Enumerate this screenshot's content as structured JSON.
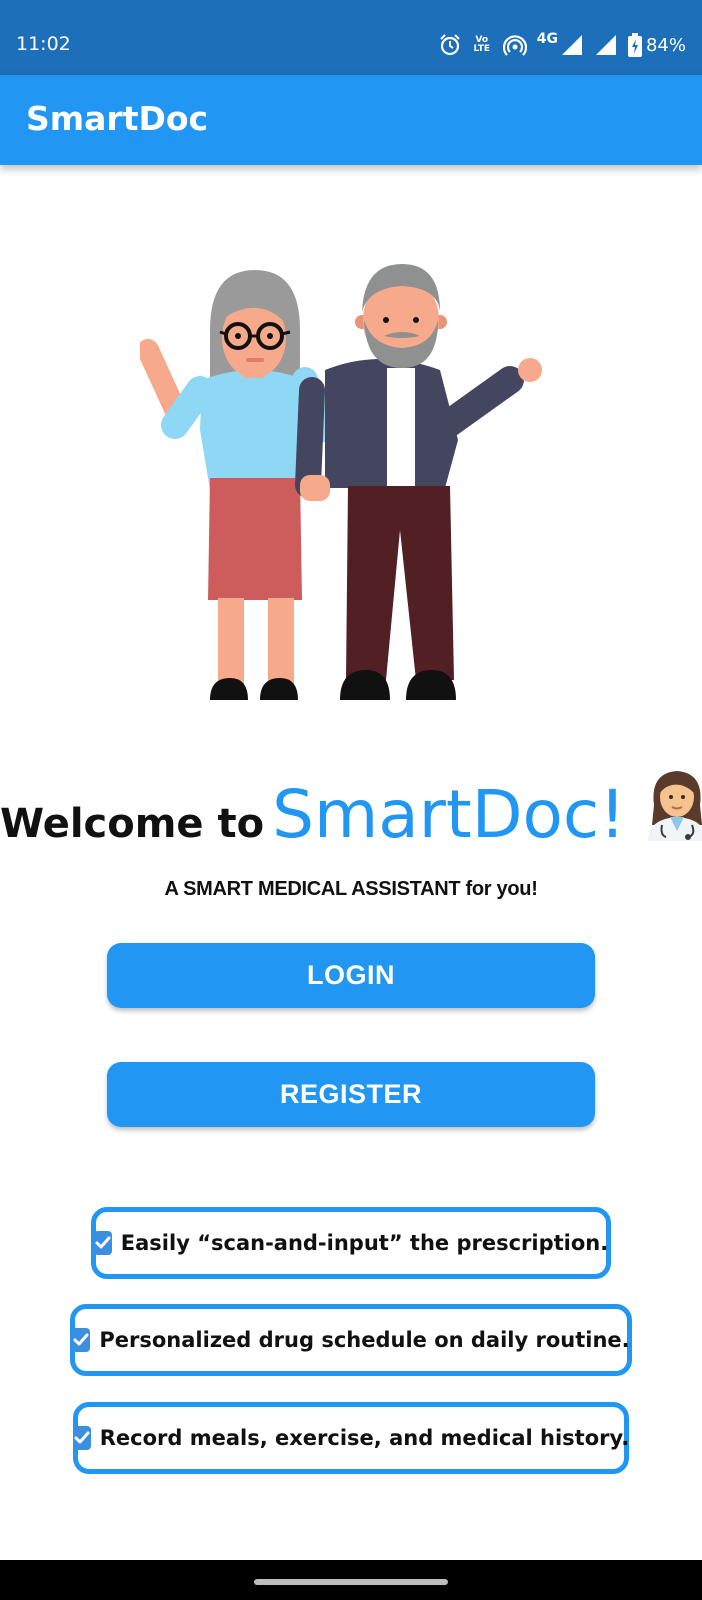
{
  "status_bar": {
    "time": "11:02",
    "network": "4G",
    "volte_label": "Vo LTE",
    "battery": "84%",
    "icons": [
      "alarm-icon",
      "volte-icon",
      "hotspot-icon",
      "signal-icon",
      "signal-icon",
      "battery-charging-icon"
    ]
  },
  "app_bar": {
    "title": "SmartDoc"
  },
  "welcome": {
    "prefix": "Welcome to",
    "brand": "SmartDoc!",
    "emoji": "health-worker-woman-icon"
  },
  "tagline": "A SMART MEDICAL ASSISTANT for you!",
  "buttons": {
    "login": "LOGIN",
    "register": "REGISTER"
  },
  "features": [
    {
      "icon": "checkbox-checked-icon",
      "text": "Easily “scan-and-input” the prescription."
    },
    {
      "icon": "checkbox-checked-icon",
      "text": "Personalized drug schedule on daily routine."
    },
    {
      "icon": "checkbox-checked-icon",
      "text": "Record meals, exercise, and medical history."
    }
  ],
  "colors": {
    "status_bar": "#1c6fb8",
    "primary": "#2196f3",
    "text": "#111111"
  }
}
